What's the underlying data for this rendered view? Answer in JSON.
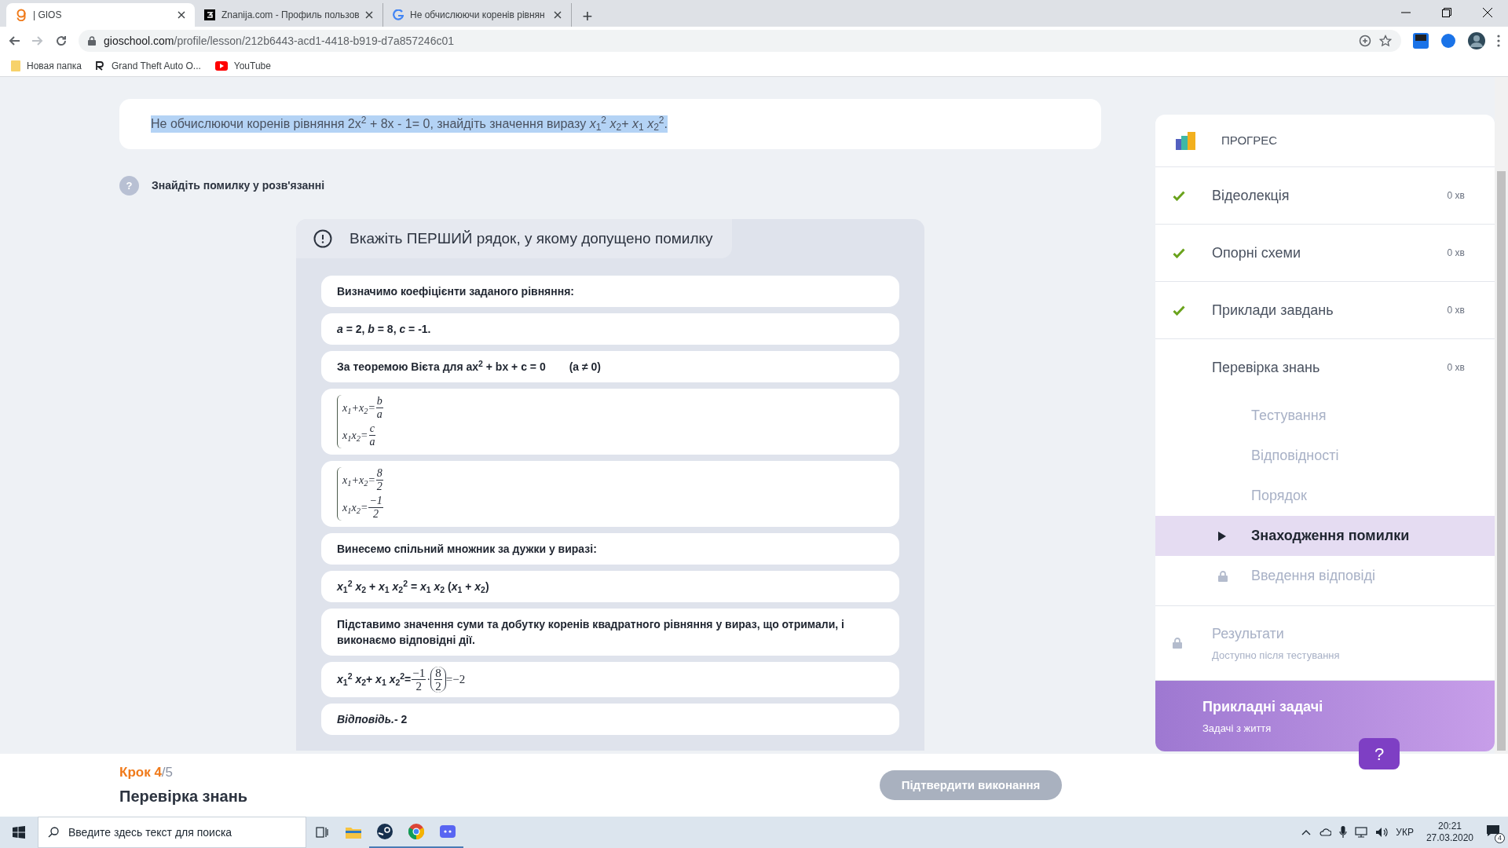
{
  "browser": {
    "tabs": [
      {
        "title": "| GIOS",
        "kind": "gios",
        "selected": true
      },
      {
        "title": "Znanija.com - Профиль пользов",
        "kind": "znanija",
        "selected": false
      },
      {
        "title": "Не обчислюючи коренів рівнян",
        "kind": "google",
        "selected": false
      }
    ],
    "new_tab": "+",
    "url": {
      "domain": "gioschool.com",
      "path": "/profile/lesson/212b6443-acd1-4418-b919-d7a857246c01"
    },
    "bookmarks": [
      {
        "label": "Новая папка",
        "kind": "folder"
      },
      {
        "label": "Grand Theft Auto O...",
        "kind": "rockstar"
      },
      {
        "label": "YouTube",
        "kind": "youtube"
      }
    ]
  },
  "question": {
    "text": "Не обчислюючи коренів рівняння 2x$^{2}$ + 8x - 1= 0, знайдіть значення виразу *x*$_{1}$$^{2}$ *x*$_{2}$+ *x*$_{1}$ *x*$_{2}$$^{2}$.",
    "highlighted": true
  },
  "hint": {
    "badge": "?",
    "text": "Знайдіть помилку у розв'язанні"
  },
  "task": {
    "instruction": "Вкажіть ПЕРШИЙ рядок, у якому допущено помилку",
    "steps": [
      {
        "kind": "text",
        "text": "Визначимо коефіцієнти заданого рівняння:"
      },
      {
        "kind": "text",
        "text": "*a* = 2, *b* = 8, *c* = -1."
      },
      {
        "kind": "text",
        "text": "За теоремою Вієта для ax$^{2}$ + bx + c = 0",
        "aside": "(a ≠ 0)"
      },
      {
        "kind": "system",
        "rows": [
          {
            "lhs": "x$_{1}$+x$_{2}$=",
            "num": "b",
            "den": "a"
          },
          {
            "lhs": "x$_{1}$x$_{2}$=",
            "num": "c",
            "den": "a"
          }
        ]
      },
      {
        "kind": "system",
        "rows": [
          {
            "lhs": "x$_{1}$+x$_{2}$=",
            "num": "8",
            "den": "2"
          },
          {
            "lhs": "x$_{1}$x$_{2}$=",
            "num": "−1",
            "den": "2"
          }
        ]
      },
      {
        "kind": "text",
        "text": "Винесемо спільний множник за дужки у виразі:"
      },
      {
        "kind": "text",
        "text": "*x*$_{1}$$^{2}$ *x*$_{2}$ + *x*$_{1}$ *x*$_{2}$$^{2}$ =  *x*$_{1}$ *x*$_{2}$ (*x*$_{1}$ +  *x*$_{2}$)"
      },
      {
        "kind": "text",
        "text": "Підставимо значення суми та добутку коренів квадратного рівняння у вираз, що отримали, і виконаємо відповідні дії."
      },
      {
        "kind": "product",
        "lhs": "*x*$_{1}$$^{2}$ *x*$_{2}$+ *x*$_{1}$ *x*$_{2}$$^{2}$=",
        "factors": [
          {
            "num": "−1",
            "den": "2",
            "paren": false
          },
          {
            "num": "8",
            "den": "2",
            "paren": true
          }
        ],
        "op": "·",
        "result": "=−2"
      },
      {
        "kind": "text",
        "text": "*Відповідь.*- 2"
      }
    ]
  },
  "progress": {
    "title": "ПРОГРЕС",
    "sections": [
      {
        "label": "Відеолекція",
        "time": "0 хв",
        "done": true,
        "locked": false
      },
      {
        "label": "Опорні схеми",
        "time": "0 хв",
        "done": true,
        "locked": false
      },
      {
        "label": "Приклади завдань",
        "time": "0 хв",
        "done": true,
        "locked": false
      },
      {
        "label": "Перевірка знань",
        "time": "0 хв",
        "done": false,
        "locked": false,
        "children": [
          {
            "label": "Тестування",
            "selected": false,
            "locked": false
          },
          {
            "label": "Відповідності",
            "selected": false,
            "locked": false
          },
          {
            "label": "Порядок",
            "selected": false,
            "locked": false
          },
          {
            "label": "Знаходження помилки",
            "selected": true,
            "locked": false
          },
          {
            "label": "Введення відповіді",
            "selected": false,
            "locked": true
          }
        ]
      },
      {
        "label": "Результати",
        "subtitle": "Доступно після тестування",
        "done": false,
        "locked": true
      }
    ],
    "promo": {
      "title": "Прикладні задачі",
      "subtitle": "Задачі з життя"
    }
  },
  "help_button": "?",
  "footer": {
    "step_label": "Крок",
    "step_current": "4",
    "step_total": "/5",
    "title": "Перевірка знань",
    "button": "Підтвердити виконання",
    "button_disabled": true
  },
  "taskbar": {
    "search_placeholder": "Введите здесь текст для поиска",
    "apps": [
      {
        "kind": "task-view",
        "running": false
      },
      {
        "kind": "explorer",
        "running": false
      },
      {
        "kind": "steam",
        "running": true
      },
      {
        "kind": "chrome",
        "running": true
      },
      {
        "kind": "discord",
        "running": true
      }
    ],
    "language": "УКР",
    "time": "20:21",
    "date": "27.03.2020",
    "notifications": "4"
  }
}
